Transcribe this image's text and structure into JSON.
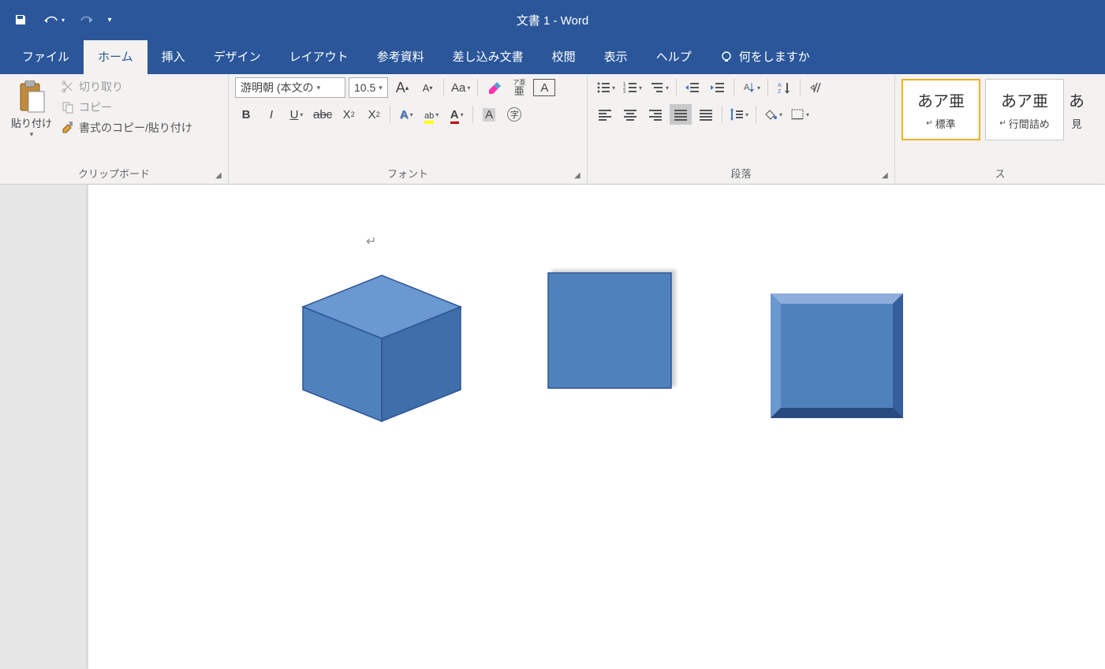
{
  "title": "文書 1  -  Word",
  "qat": {
    "save": "save",
    "undo": "undo",
    "redo": "redo"
  },
  "tabs": {
    "file": "ファイル",
    "home": "ホーム",
    "insert": "挿入",
    "design": "デザイン",
    "layout": "レイアウト",
    "references": "参考資料",
    "mailings": "差し込み文書",
    "review": "校閲",
    "view": "表示",
    "help": "ヘルプ",
    "tellme": "何をしますか"
  },
  "clipboard": {
    "paste": "貼り付け",
    "cut": "切り取り",
    "copy": "コピー",
    "format_painter": "書式のコピー/貼り付け",
    "label": "クリップボード"
  },
  "font": {
    "name": "游明朝 (本文の",
    "size": "10.5",
    "label": "フォント",
    "aa": "Aa",
    "ruby": "ア亜",
    "abc": "abc"
  },
  "paragraph": {
    "label": "段落"
  },
  "styles": {
    "sample": "あア亜",
    "normal": "標準",
    "no_spacing": "行間詰め",
    "heading_cut": "見",
    "label": "ス"
  },
  "colors": {
    "word_blue": "#2b579a",
    "ribbon_bg": "#f3f2f1",
    "shape_fill": "#4f81bd",
    "shape_fill_light": "#5b8bc9",
    "shape_edge_dark": "#2f5597",
    "shape_top": "#6a98d0"
  }
}
